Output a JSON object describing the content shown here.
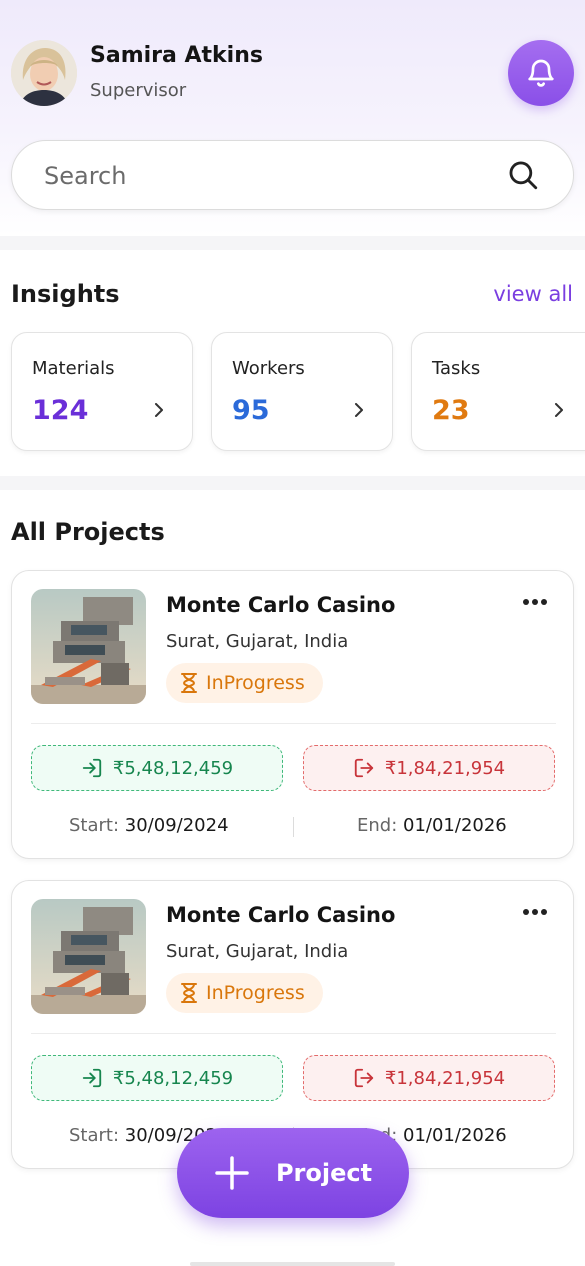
{
  "user": {
    "name": "Samira Atkins",
    "role": "Supervisor"
  },
  "search": {
    "placeholder": "Search"
  },
  "insights": {
    "title": "Insights",
    "view_all": "view all",
    "cards": [
      {
        "label": "Materials",
        "value": "124",
        "color": "#6a2fd8"
      },
      {
        "label": "Workers",
        "value": "95",
        "color": "#2b6ad9"
      },
      {
        "label": "Tasks",
        "value": "23",
        "color": "#e07a10"
      }
    ]
  },
  "projects": {
    "title": "All Projects",
    "items": [
      {
        "name": "Monte Carlo Casino",
        "location": "Surat, Gujarat, India",
        "status": "InProgress",
        "income": "₹5,48,12,459",
        "expense": "₹1,84,21,954",
        "start_label": "Start:",
        "start": "30/09/2024",
        "end_label": "End:",
        "end": "01/01/2026"
      },
      {
        "name": "Monte Carlo Casino",
        "location": "Surat, Gujarat, India",
        "status": "InProgress",
        "income": "₹5,48,12,459",
        "expense": "₹1,84,21,954",
        "start_label": "Start:",
        "start": "30/09/2024",
        "end_label": "End:",
        "end": "01/01/2026"
      }
    ]
  },
  "fab": {
    "label": "Project",
    "icon": "plus-icon"
  },
  "icons": {
    "bell": "bell-icon",
    "search": "search-icon",
    "chevron": "chevron-right-icon",
    "more": "more-horizontal-icon",
    "status": "hourglass-icon",
    "income": "sign-in-icon",
    "expense": "sign-out-icon"
  },
  "colors": {
    "accent": "#8a4fe8",
    "income": "#17864f",
    "expense": "#c8343a",
    "status": "#d9770c"
  }
}
